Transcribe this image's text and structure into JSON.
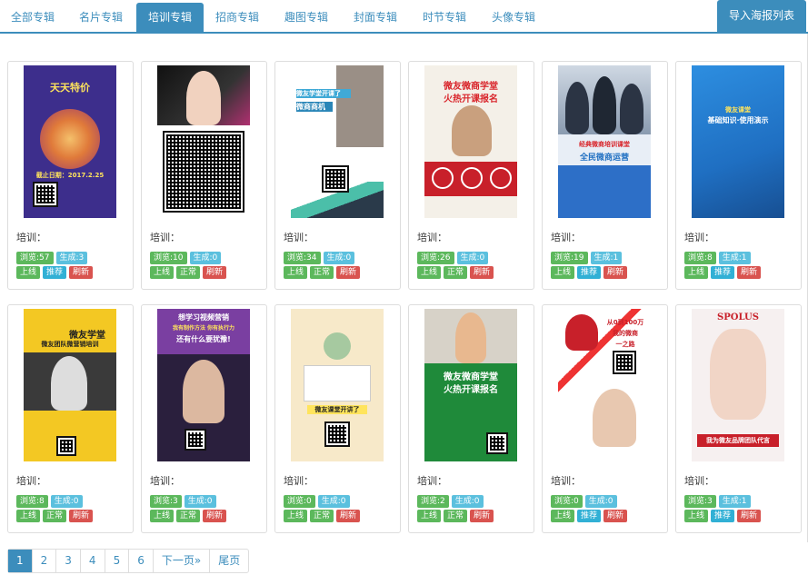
{
  "tabs": [
    "全部专辑",
    "名片专辑",
    "培训专辑",
    "招商专辑",
    "趣图专辑",
    "封面专辑",
    "时节专辑",
    "头像专辑"
  ],
  "import_button": "导入海报列表",
  "cards": [
    {
      "label": "培训：",
      "views": "浏览:57",
      "generated": "生成:3",
      "actions": [
        "上线",
        "推荐",
        "刷新"
      ],
      "poster_texts": [
        "天天特价",
        "截止日期：2017.2.25"
      ]
    },
    {
      "label": "培训：",
      "views": "浏览:10",
      "generated": "生成:0",
      "actions": [
        "上线",
        "正常",
        "刷新"
      ],
      "poster_texts": []
    },
    {
      "label": "培训：",
      "views": "浏览:34",
      "generated": "生成:0",
      "actions": [
        "上线",
        "正常",
        "刷新"
      ],
      "poster_texts": [
        "微友学堂开课了",
        "微商商机"
      ]
    },
    {
      "label": "培训：",
      "views": "浏览:26",
      "generated": "生成:0",
      "actions": [
        "上线",
        "正常",
        "刷新"
      ],
      "poster_texts": [
        "微友微商学堂",
        "火热开课报名"
      ]
    },
    {
      "label": "培训：",
      "views": "浏览:19",
      "generated": "生成:1",
      "actions": [
        "上线",
        "推荐",
        "刷新"
      ],
      "poster_texts": [
        "经典微商培训课堂",
        "全民微商运营"
      ]
    },
    {
      "label": "培训：",
      "views": "浏览:8",
      "generated": "生成:1",
      "actions": [
        "上线",
        "推荐",
        "刷新"
      ],
      "poster_texts": [
        "微友课堂",
        "基础知识·使用演示"
      ]
    },
    {
      "label": "培训：",
      "views": "浏览:8",
      "generated": "生成:0",
      "actions": [
        "上线",
        "正常",
        "刷新"
      ],
      "poster_texts": [
        "微友学堂",
        "微友团队微营销培训"
      ]
    },
    {
      "label": "培训：",
      "views": "浏览:3",
      "generated": "生成:0",
      "actions": [
        "上线",
        "正常",
        "刷新"
      ],
      "poster_texts": [
        "想学习视频营销",
        "我有制作方法 你有执行力",
        "还有什么要犹豫!"
      ]
    },
    {
      "label": "培训：",
      "views": "浏览:0",
      "generated": "生成:0",
      "actions": [
        "上线",
        "正常",
        "刷新"
      ],
      "poster_texts": [
        "微友课堂开讲了"
      ]
    },
    {
      "label": "培训：",
      "views": "浏览:2",
      "generated": "生成:0",
      "actions": [
        "上线",
        "正常",
        "刷新"
      ],
      "poster_texts": [
        "微友微商学堂",
        "火热开课报名"
      ]
    },
    {
      "label": "培训：",
      "views": "浏览:0",
      "generated": "生成:0",
      "actions": [
        "上线",
        "推荐",
        "刷新"
      ],
      "poster_texts": [
        "从0到100万",
        "我的微商",
        "一之路"
      ]
    },
    {
      "label": "培训：",
      "views": "浏览:3",
      "generated": "生成:1",
      "actions": [
        "上线",
        "推荐",
        "刷新"
      ],
      "poster_texts": [
        "SPOLUS",
        "我为微友品牌团队代言"
      ]
    }
  ],
  "pagination": [
    "1",
    "2",
    "3",
    "4",
    "5",
    "6",
    "下一页»",
    "尾页"
  ],
  "colors": {
    "accent": "#3c8dbc",
    "green": "#5cb85c",
    "blue": "#5bc0de",
    "red": "#d9534f"
  }
}
